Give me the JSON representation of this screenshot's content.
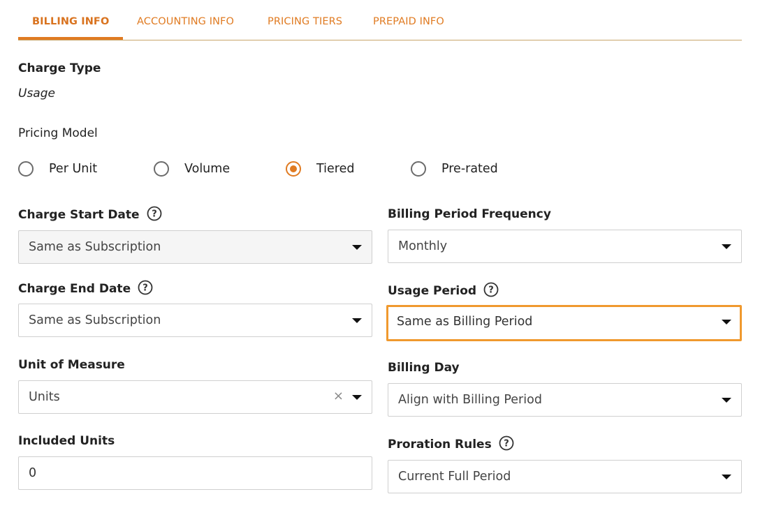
{
  "tabs": [
    {
      "label": "BILLING INFO",
      "active": true
    },
    {
      "label": "ACCOUNTING INFO",
      "active": false
    },
    {
      "label": "PRICING TIERS",
      "active": false
    },
    {
      "label": "PREPAID INFO",
      "active": false
    }
  ],
  "colors": {
    "accent": "#e07b22",
    "focus_border": "#f0992e",
    "divider": "#c8a56a"
  },
  "charge_type": {
    "label": "Charge Type",
    "value": "Usage"
  },
  "pricing_model": {
    "label": "Pricing Model",
    "options": [
      {
        "label": "Per Unit",
        "selected": false
      },
      {
        "label": "Volume",
        "selected": false
      },
      {
        "label": "Tiered",
        "selected": true
      },
      {
        "label": "Pre-rated",
        "selected": false
      }
    ]
  },
  "left": {
    "charge_start_date": {
      "label": "Charge Start Date",
      "value": "Same as Subscription",
      "help_icon": "question-circle-icon"
    },
    "charge_end_date": {
      "label": "Charge End Date",
      "value": "Same as Subscription",
      "help_icon": "question-circle-icon"
    },
    "unit_of_measure": {
      "label": "Unit of Measure",
      "value": "Units"
    },
    "included_units": {
      "label": "Included Units",
      "value": "0"
    }
  },
  "right": {
    "billing_period_frequency": {
      "label": "Billing Period Frequency",
      "value": "Monthly"
    },
    "usage_period": {
      "label": "Usage Period",
      "value": "Same as Billing Period",
      "help_icon": "question-circle-icon"
    },
    "billing_day": {
      "label": "Billing Day",
      "value": "Align with Billing Period"
    },
    "proration_rules": {
      "label": "Proration Rules",
      "value": "Current Full Period",
      "help_icon": "question-circle-icon"
    }
  }
}
